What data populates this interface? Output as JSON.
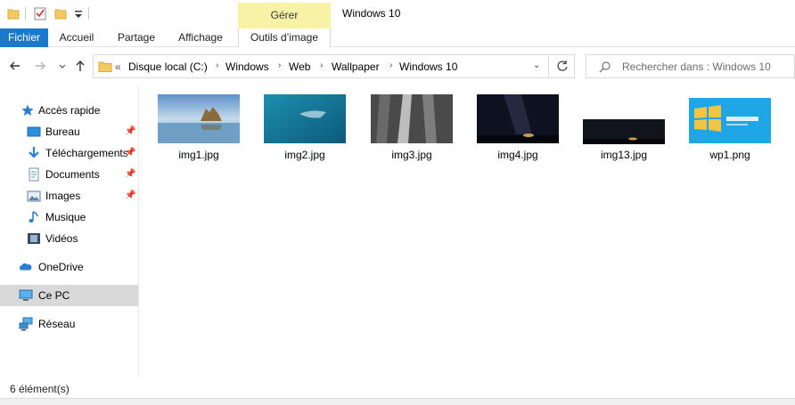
{
  "window": {
    "title": "Windows 10",
    "contextual_tab_group": "Gérer"
  },
  "ribbon": {
    "tabs": [
      {
        "label": "Fichier"
      },
      {
        "label": "Accueil"
      },
      {
        "label": "Partage"
      },
      {
        "label": "Affichage"
      },
      {
        "label": "Outils d’image"
      }
    ]
  },
  "address": {
    "overflow": "«",
    "crumbs": [
      "Disque local (C:)",
      "Windows",
      "Web",
      "Wallpaper",
      "Windows 10"
    ]
  },
  "search": {
    "placeholder": "Rechercher dans : Windows 10"
  },
  "sidebar": {
    "items": [
      {
        "label": "Accès rapide",
        "icon": "star-icon"
      },
      {
        "label": "Bureau",
        "icon": "desktop-folder-icon",
        "pinned": true
      },
      {
        "label": "Téléchargements",
        "icon": "download-icon",
        "pinned": true
      },
      {
        "label": "Documents",
        "icon": "documents-icon",
        "pinned": true
      },
      {
        "label": "Images",
        "icon": "pictures-icon",
        "pinned": true
      },
      {
        "label": "Musique",
        "icon": "music-icon"
      },
      {
        "label": "Vidéos",
        "icon": "videos-icon"
      },
      {
        "label": "OneDrive",
        "icon": "cloud-icon"
      },
      {
        "label": "Ce PC",
        "icon": "computer-icon",
        "selected": true
      },
      {
        "label": "Réseau",
        "icon": "network-icon"
      }
    ]
  },
  "files": [
    {
      "name": "img1.jpg"
    },
    {
      "name": "img2.jpg"
    },
    {
      "name": "img3.jpg"
    },
    {
      "name": "img4.jpg"
    },
    {
      "name": "img13.jpg"
    },
    {
      "name": "wp1.png"
    }
  ],
  "status": {
    "count": "6 élément(s)"
  },
  "colors": {
    "accent": "#1979ca",
    "manage_tab": "#f7f2a6",
    "selection": "#d9d9d9"
  }
}
